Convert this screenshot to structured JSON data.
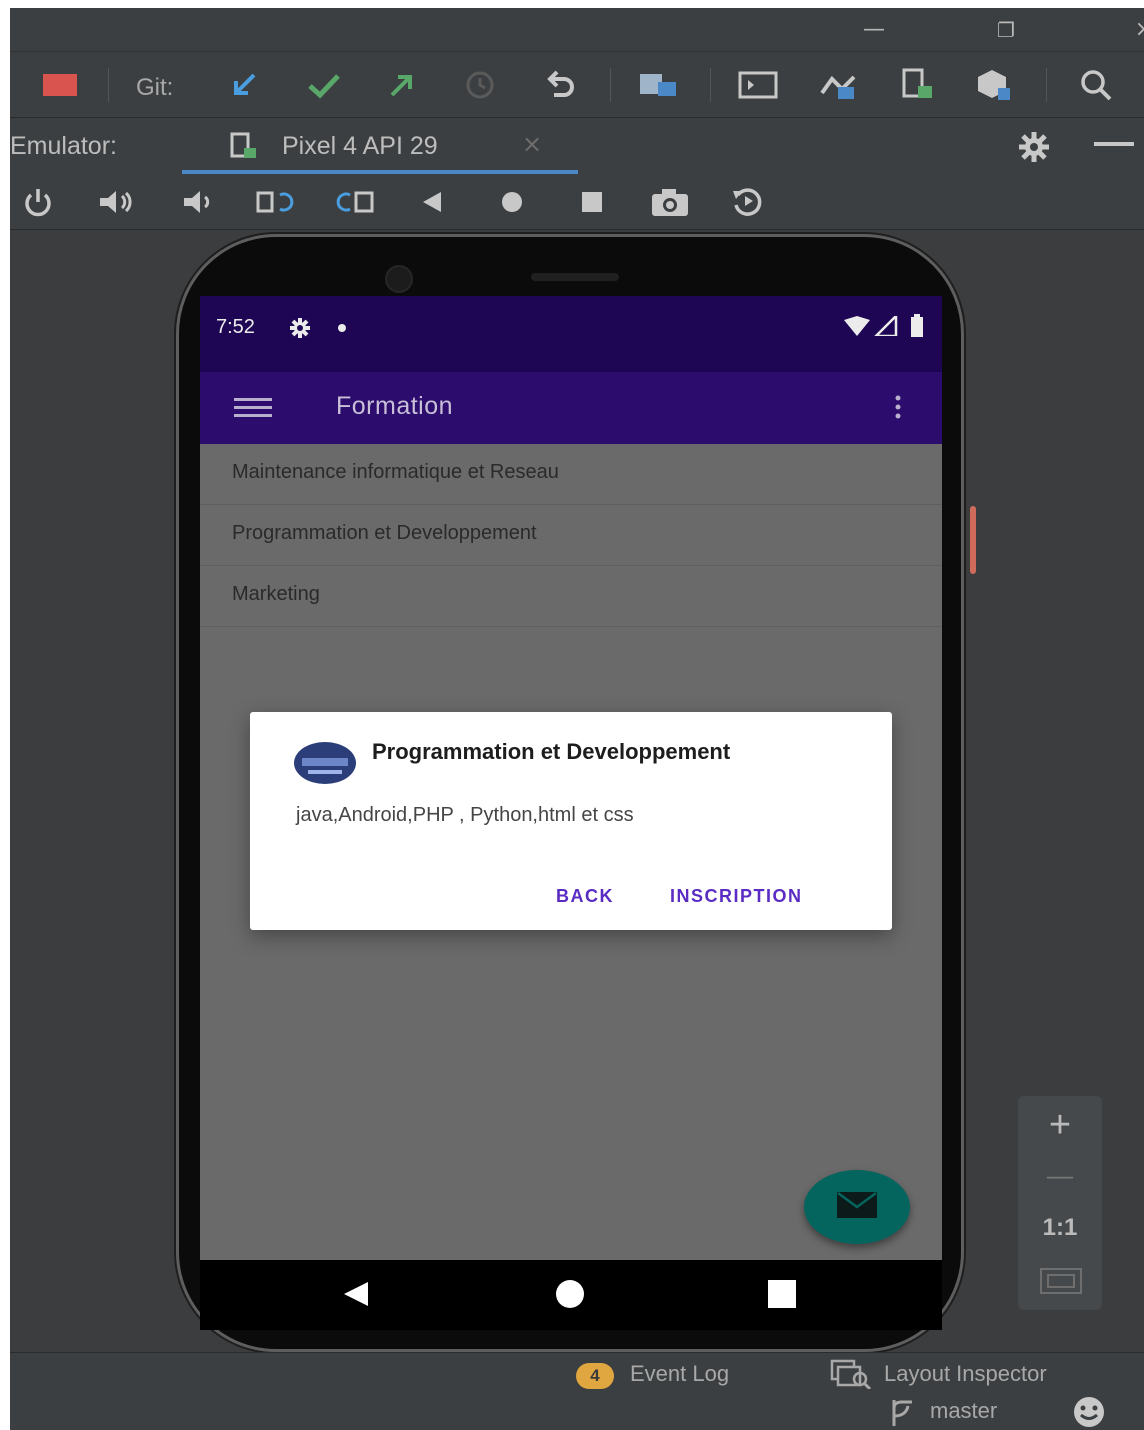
{
  "ide": {
    "window_controls": {
      "minimize": "—",
      "restore": "❐",
      "close": "×"
    },
    "toolbar": {
      "git_label": "Git:",
      "icons": [
        "stop-icon",
        "git-update-icon",
        "git-commit-icon",
        "git-push-icon",
        "history-icon",
        "revert-icon",
        "project-structure-icon",
        "terminal-icon",
        "avd-manager-icon",
        "device-manager-icon",
        "sdk-manager-icon",
        "search-icon"
      ]
    },
    "emulator_tab": {
      "label": "Emulator:",
      "device_tab": "Pixel 4 API 29",
      "close": "×"
    },
    "device_controls": [
      "power-icon",
      "volume-up-icon",
      "volume-down-icon",
      "rotate-left-icon",
      "rotate-right-icon",
      "back-icon",
      "home-icon",
      "overview-icon",
      "screenshot-icon",
      "snapshot-icon"
    ],
    "zoom": {
      "in": "+",
      "out": "—",
      "actual": "1:1"
    },
    "bottom": {
      "event_count": "4",
      "event_log": "Event Log",
      "layout_inspector": "Layout Inspector",
      "branch": "master"
    }
  },
  "device": {
    "status_time": "7:52",
    "app_title": "Formation",
    "list": [
      "Maintenance informatique et Reseau",
      "Programmation et Developpement",
      "Marketing"
    ],
    "dialog": {
      "title": "Programmation et Developpement",
      "message": "java,Android,PHP , Python,html et css",
      "negative": "BACK",
      "positive": "INSCRIPTION"
    }
  },
  "colors": {
    "status_bar": "#1e0654",
    "app_bar": "#2c0c6c",
    "dialog_button": "#5a2cc4",
    "fab": "#04655e",
    "tab_underline": "#4a88c7"
  }
}
